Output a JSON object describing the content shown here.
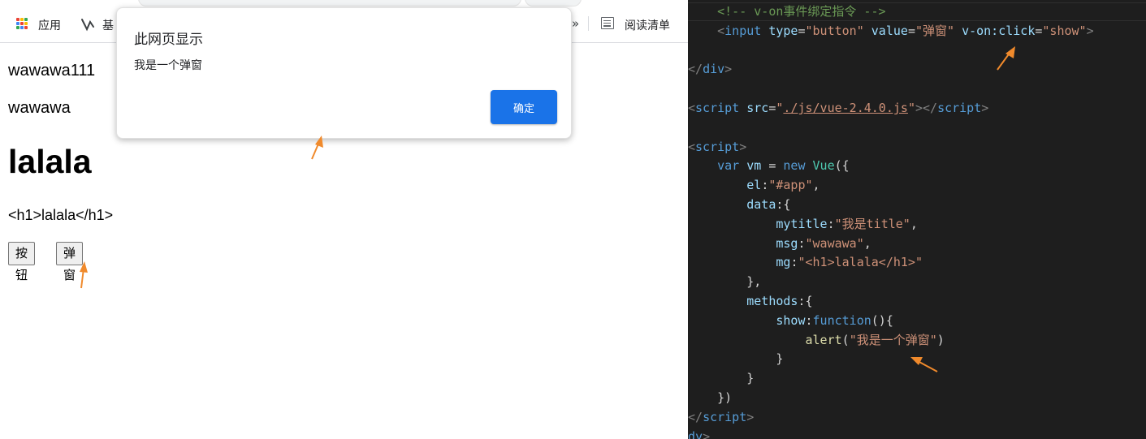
{
  "browser": {
    "bookmarks": {
      "apps_label": "应用",
      "base_label": "基",
      "overflow_label": "»",
      "reading_list_label": "阅读清单"
    },
    "page": {
      "line1": "wawawa111",
      "line2": "wawawa",
      "heading": "lalala",
      "raw_html": "<h1>lalala</h1>",
      "button1_label": "按钮",
      "button2_label": "弹窗"
    },
    "alert": {
      "title": "此网页显示",
      "message": "我是一个弹窗",
      "ok_label": "确定"
    }
  },
  "editor": {
    "lines": [
      [
        [
          "c-com",
          "    <!-- v-on事件绑定指令 -->"
        ]
      ],
      [
        [
          "c-txt",
          "    "
        ],
        [
          "c-br",
          "<"
        ],
        [
          "c-tag",
          "input"
        ],
        [
          "c-txt",
          " "
        ],
        [
          "c-attr",
          "type"
        ],
        [
          "c-txt",
          "="
        ],
        [
          "c-str",
          "\"button\""
        ],
        [
          "c-txt",
          " "
        ],
        [
          "c-attr",
          "value"
        ],
        [
          "c-txt",
          "="
        ],
        [
          "c-str",
          "\"弹窗\""
        ],
        [
          "c-txt",
          " "
        ],
        [
          "c-attr",
          "v-on:click"
        ],
        [
          "c-txt",
          "="
        ],
        [
          "c-str",
          "\"show\""
        ],
        [
          "c-br",
          ">"
        ]
      ],
      [
        [
          "c-txt",
          ""
        ]
      ],
      [
        [
          "c-br",
          "</"
        ],
        [
          "c-tag",
          "div"
        ],
        [
          "c-br",
          ">"
        ]
      ],
      [
        [
          "c-txt",
          ""
        ]
      ],
      [
        [
          "c-br",
          "<"
        ],
        [
          "c-tag",
          "script"
        ],
        [
          "c-txt",
          " "
        ],
        [
          "c-attr",
          "src"
        ],
        [
          "c-txt",
          "="
        ],
        [
          "c-str",
          "\""
        ],
        [
          "c-link",
          "./js/vue-2.4.0.js"
        ],
        [
          "c-str",
          "\""
        ],
        [
          "c-br",
          "></"
        ],
        [
          "c-tag",
          "script"
        ],
        [
          "c-br",
          ">"
        ]
      ],
      [
        [
          "c-txt",
          ""
        ]
      ],
      [
        [
          "c-br",
          "<"
        ],
        [
          "c-tag",
          "script"
        ],
        [
          "c-br",
          ">"
        ]
      ],
      [
        [
          "c-txt",
          "    "
        ],
        [
          "c-kw",
          "var"
        ],
        [
          "c-txt",
          " "
        ],
        [
          "c-attr",
          "vm"
        ],
        [
          "c-txt",
          " = "
        ],
        [
          "c-kw",
          "new"
        ],
        [
          "c-txt",
          " "
        ],
        [
          "c-cls",
          "Vue"
        ],
        [
          "c-txt",
          "({"
        ]
      ],
      [
        [
          "c-txt",
          "        "
        ],
        [
          "c-attr",
          "el"
        ],
        [
          "c-txt",
          ":"
        ],
        [
          "c-str",
          "\"#app\""
        ],
        [
          "c-txt",
          ","
        ]
      ],
      [
        [
          "c-txt",
          "        "
        ],
        [
          "c-attr",
          "data"
        ],
        [
          "c-txt",
          ":{"
        ]
      ],
      [
        [
          "c-txt",
          "            "
        ],
        [
          "c-attr",
          "mytitle"
        ],
        [
          "c-txt",
          ":"
        ],
        [
          "c-str",
          "\"我是title\""
        ],
        [
          "c-txt",
          ","
        ]
      ],
      [
        [
          "c-txt",
          "            "
        ],
        [
          "c-attr",
          "msg"
        ],
        [
          "c-txt",
          ":"
        ],
        [
          "c-str",
          "\"wawawa\""
        ],
        [
          "c-txt",
          ","
        ]
      ],
      [
        [
          "c-txt",
          "            "
        ],
        [
          "c-attr",
          "mg"
        ],
        [
          "c-txt",
          ":"
        ],
        [
          "c-str",
          "\"<h1>lalala</h1>\""
        ]
      ],
      [
        [
          "c-txt",
          "        },"
        ]
      ],
      [
        [
          "c-txt",
          "        "
        ],
        [
          "c-attr",
          "methods"
        ],
        [
          "c-txt",
          ":{"
        ]
      ],
      [
        [
          "c-txt",
          "            "
        ],
        [
          "c-attr",
          "show"
        ],
        [
          "c-txt",
          ":"
        ],
        [
          "c-kw",
          "function"
        ],
        [
          "c-txt",
          "(){"
        ]
      ],
      [
        [
          "c-txt",
          "                "
        ],
        [
          "c-fn",
          "alert"
        ],
        [
          "c-txt",
          "("
        ],
        [
          "c-str",
          "\"我是一个弹窗\""
        ],
        [
          "c-txt",
          ")"
        ]
      ],
      [
        [
          "c-txt",
          "            }"
        ]
      ],
      [
        [
          "c-txt",
          "        }"
        ]
      ],
      [
        [
          "c-txt",
          "    })"
        ]
      ],
      [
        [
          "c-br",
          "</"
        ],
        [
          "c-tag",
          "script"
        ],
        [
          "c-br",
          ">"
        ]
      ],
      [
        [
          "c-tag",
          "dy"
        ],
        [
          "c-br",
          ">"
        ]
      ]
    ]
  },
  "colors": {
    "editor_bg": "#1e1e1e",
    "alert_button": "#1a73e8",
    "annotation_arrow": "#f08a2c"
  }
}
